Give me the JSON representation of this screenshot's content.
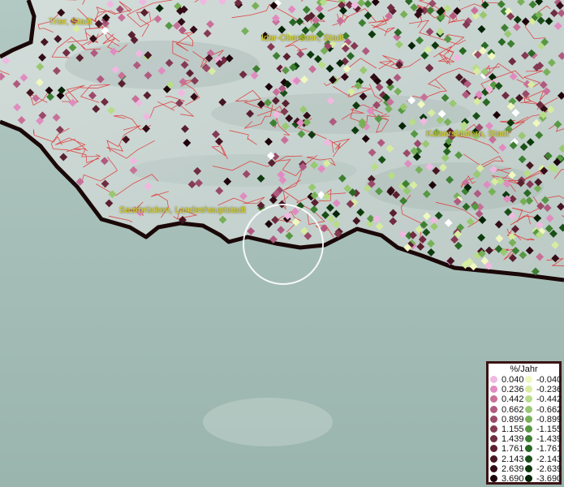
{
  "map": {
    "cities": [
      {
        "id": "trier",
        "label": "Trier, Stadt"
      },
      {
        "id": "idar",
        "label": "Idar-Oberstein, Stadt"
      },
      {
        "id": "kaiserslautern",
        "label": "Kaiserslautern, Stadt"
      },
      {
        "id": "saarbruecken",
        "label": "Saarbrücken, Landeshauptstadt"
      }
    ],
    "colors": {
      "water": "#a9c2bb",
      "land": "#c9d6d3",
      "boundary": "#e03030",
      "coast": "#1a0808"
    }
  },
  "legend": {
    "title": "%/Jahr",
    "positive": [
      {
        "value": "0.040",
        "color": "#f0b8e0"
      },
      {
        "value": "0.236",
        "color": "#e08cc0"
      },
      {
        "value": "0.442",
        "color": "#c87098"
      },
      {
        "value": "0.662",
        "color": "#b05a80"
      },
      {
        "value": "0.899",
        "color": "#9a4a68"
      },
      {
        "value": "1.155",
        "color": "#843a52"
      },
      {
        "value": "1.439",
        "color": "#702c40"
      },
      {
        "value": "1.761",
        "color": "#5a2030"
      },
      {
        "value": "2.143",
        "color": "#461622"
      },
      {
        "value": "2.639",
        "color": "#320c16"
      },
      {
        "value": "3.690",
        "color": "#1e040a"
      }
    ],
    "negative": [
      {
        "value": "-0.040",
        "color": "#f0f8c0"
      },
      {
        "value": "-0.236",
        "color": "#d8eca0"
      },
      {
        "value": "-0.442",
        "color": "#b8dc88"
      },
      {
        "value": "-0.662",
        "color": "#98c870"
      },
      {
        "value": "-0.899",
        "color": "#78b058"
      },
      {
        "value": "-1.155",
        "color": "#589844"
      },
      {
        "value": "-1.439",
        "color": "#3e8032"
      },
      {
        "value": "-1.761",
        "color": "#2a6824"
      },
      {
        "value": "-2.143",
        "color": "#1a5018"
      },
      {
        "value": "-2.639",
        "color": "#0e3a0e"
      },
      {
        "value": "-3.690",
        "color": "#062406"
      }
    ]
  }
}
